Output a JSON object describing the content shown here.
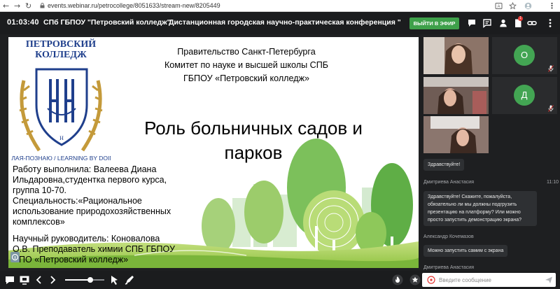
{
  "browser": {
    "url": "events.webinar.ru/petrocollege/8051633/stream-new/8205449"
  },
  "header": {
    "time": "01:03:40",
    "organization": "СПб ГБПОУ \"Петровский колледж\"",
    "title": "Дистанционная городская научно-практическая конференция \"Эк...",
    "live_button": "ВЫЙТИ В ЭФИР",
    "notification_count": "1"
  },
  "slide": {
    "logo_name": "ПЕТРОВСКИЙ КОЛЛЕДЖ",
    "logo_letters": "Н",
    "logo_motto": "ДЕЛАЯ-ПОЗНАЮ / LEARNING BY DOING",
    "header_lines": [
      "Правительство  Санкт-Петербурга",
      "Комитет по науке и высшей школы СПБ",
      "ГБПОУ «Петровский колледж»"
    ],
    "title_lines": [
      "Роль больничных садов и",
      "парков"
    ],
    "info_lines": [
      "Работу выполнила: Валеева Диана",
      "Ильдаровна,студентка первого курса,",
      "группа 10-70.",
      "Специальность:«Рациональное",
      "использование природохозяйственных",
      "комплексов»",
      "",
      "Научный    руководитель:    Коновалова",
      "О.В.  Преподаватель химии СПБ ГБПОУ",
      "СПО «Петровский колледж»"
    ]
  },
  "videos": [
    {
      "type": "camera"
    },
    {
      "type": "avatar",
      "initial": "О"
    },
    {
      "type": "camera"
    },
    {
      "type": "avatar",
      "initial": "Д"
    },
    {
      "type": "camera"
    }
  ],
  "chat": {
    "messages": [
      {
        "author": "",
        "time": "",
        "text": "Здравствуйте!"
      },
      {
        "author": "Дмитриева Анастасия",
        "time": "11:10",
        "text": "Здравствуйте! Скажите, пожалуйста, обязательно ли мы должны подгрузить презентацию на платформу? Или можно просто запустить демонстрацию экрана?"
      },
      {
        "author": "Александр Кочемазов",
        "time": "",
        "text": "Можно запустить самим с экрана"
      },
      {
        "author": "Дмитриева Анастасия",
        "time": "",
        "text": ""
      }
    ],
    "input_placeholder": "Введите сообщение"
  },
  "colors": {
    "accent_green": "#3ea04a",
    "avatar_green": "#43a553",
    "dark_bg": "#1e1f21"
  }
}
